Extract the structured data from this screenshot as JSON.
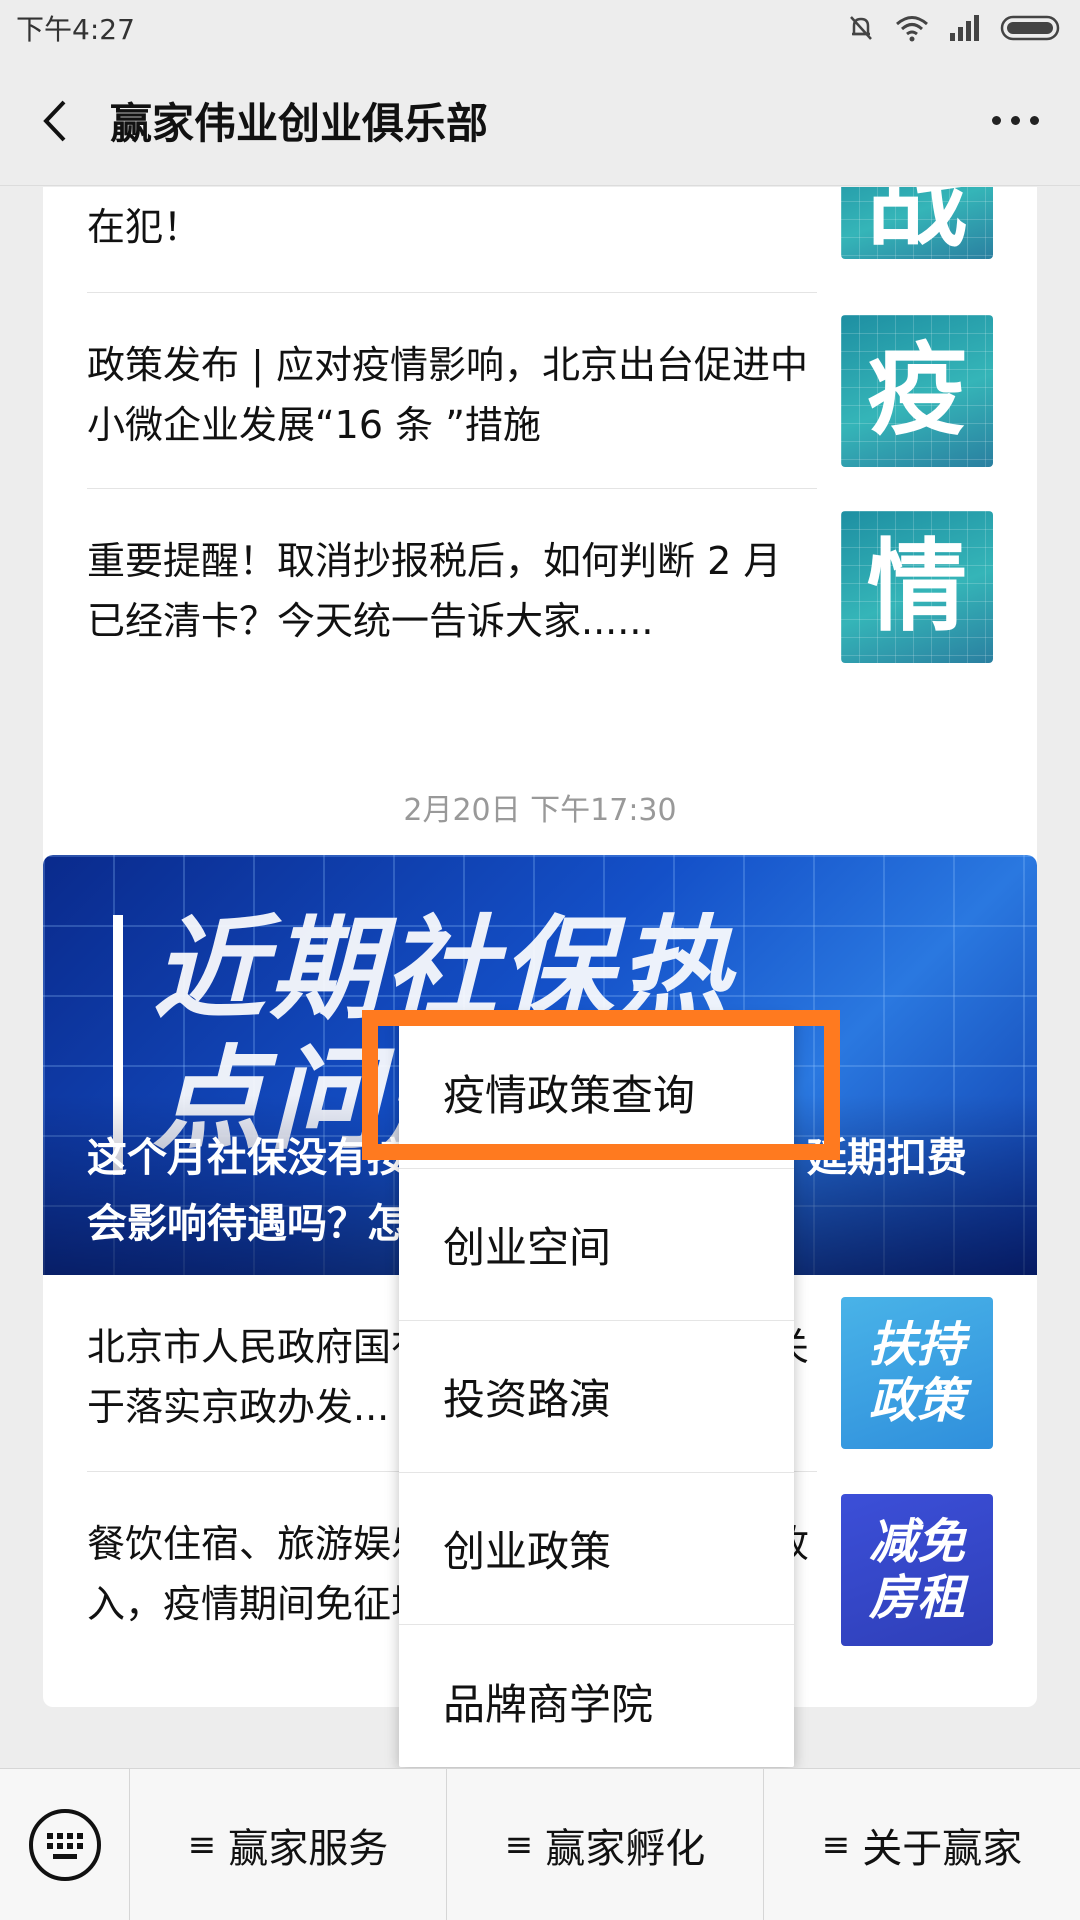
{
  "status_bar": {
    "time": "下午4:27"
  },
  "nav": {
    "title": "赢家伟业创业俱乐部"
  },
  "articles_top": [
    {
      "title": "在犯！",
      "thumb_char": "战"
    },
    {
      "title": "政策发布 | 应对疫情影响，北京出台促进中小微企业发展“16 条 ”措施",
      "thumb_char": "疫"
    },
    {
      "title": "重要提醒！取消抄报税后，如何判断 2 月已经清卡？今天统一告诉大家......",
      "thumb_char": "情"
    }
  ],
  "timestamp": "2月20日 下午17:30",
  "banner": {
    "headline_line1": "近期社保热",
    "headline_line2": "点问题",
    "title": "这个月社保没有按时扣费能否申请延期？延期扣费会影响待遇吗？怎么申请延期社保..."
  },
  "articles_bottom": [
    {
      "title": "北京市人民政府国有资产监督管理委员会关于落实京政办发...",
      "thumb_text": [
        "扶持",
        "政策"
      ]
    },
    {
      "title": "餐饮住宿、旅游娱乐等行业提供生活服务收入，疫情期间免征增值税",
      "thumb_text": [
        "减免",
        "房租"
      ]
    }
  ],
  "popup_menu": {
    "items": [
      "疫情政策查询",
      "创业空间",
      "投资路演",
      "创业政策",
      "品牌商学院"
    ]
  },
  "bottom_menu": {
    "tabs": [
      "赢家服务",
      "赢家孵化",
      "关于赢家"
    ],
    "hamburger": "≡"
  },
  "colors": {
    "highlight": "#ff7a1f",
    "background": "#ededed"
  }
}
